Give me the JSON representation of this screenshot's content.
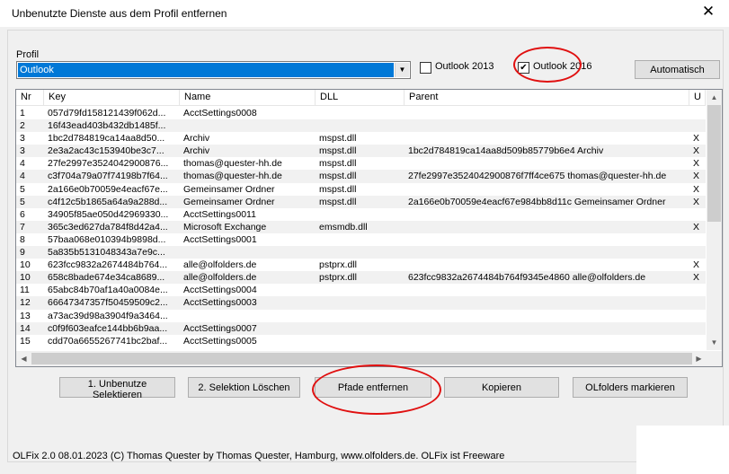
{
  "window": {
    "title": "Unbenutzte Dienste aus dem Profil entfernen",
    "close_glyph": "✕"
  },
  "profile": {
    "label": "Profil",
    "selected": "Outlook"
  },
  "checkboxes": [
    {
      "label": "Outlook 2013",
      "checked": false
    },
    {
      "label": "Outlook 2016",
      "checked": true
    }
  ],
  "automatisch_label": "Automatisch",
  "table": {
    "columns": [
      "Nr",
      "Key",
      "Name",
      "DLL",
      "Parent",
      "U"
    ],
    "rows": [
      {
        "nr": "1",
        "key": "057d79fd158121439f062d...",
        "name": "AcctSettings0008",
        "dll": "",
        "parent": "",
        "u": ""
      },
      {
        "nr": "2",
        "key": "16f43ead403b432db1485f...",
        "name": "",
        "dll": "",
        "parent": "",
        "u": ""
      },
      {
        "nr": "3",
        "key": "1bc2d784819ca14aa8d50...",
        "name": "Archiv",
        "dll": "mspst.dll",
        "parent": "",
        "u": "X"
      },
      {
        "nr": "3",
        "key": "2e3a2ac43c153940be3c7...",
        "name": "Archiv",
        "dll": "mspst.dll",
        "parent": "1bc2d784819ca14aa8d509b85779b6e4 Archiv",
        "u": "X"
      },
      {
        "nr": "4",
        "key": "27fe2997e3524042900876...",
        "name": "thomas@quester-hh.de",
        "dll": "mspst.dll",
        "parent": "",
        "u": "X"
      },
      {
        "nr": "4",
        "key": "c3f704a79a07f74198b7f64...",
        "name": "thomas@quester-hh.de",
        "dll": "mspst.dll",
        "parent": "27fe2997e3524042900876f7ff4ce675 thomas@quester-hh.de",
        "u": "X"
      },
      {
        "nr": "5",
        "key": "2a166e0b70059e4eacf67e...",
        "name": "Gemeinsamer Ordner",
        "dll": "mspst.dll",
        "parent": "",
        "u": "X"
      },
      {
        "nr": "5",
        "key": "c4f12c5b1865a64a9a288d...",
        "name": "Gemeinsamer Ordner",
        "dll": "mspst.dll",
        "parent": "2a166e0b70059e4eacf67e984bb8d11c Gemeinsamer Ordner",
        "u": "X"
      },
      {
        "nr": "6",
        "key": "34905f85ae050d42969330...",
        "name": "AcctSettings0011",
        "dll": "",
        "parent": "",
        "u": ""
      },
      {
        "nr": "7",
        "key": "365c3ed627da784f8d42a4...",
        "name": "Microsoft Exchange",
        "dll": "emsmdb.dll",
        "parent": "",
        "u": "X"
      },
      {
        "nr": "8",
        "key": "57baa068e010394b9898d...",
        "name": "AcctSettings0001",
        "dll": "",
        "parent": "",
        "u": ""
      },
      {
        "nr": "9",
        "key": "5a835b5131048343a7e9c...",
        "name": "",
        "dll": "",
        "parent": "",
        "u": ""
      },
      {
        "nr": "10",
        "key": "623fcc9832a2674484b764...",
        "name": "alle@olfolders.de",
        "dll": "pstprx.dll",
        "parent": "",
        "u": "X"
      },
      {
        "nr": "10",
        "key": "658c8bade674e34ca8689...",
        "name": "alle@olfolders.de",
        "dll": "pstprx.dll",
        "parent": "623fcc9832a2674484b764f9345e4860 alle@olfolders.de",
        "u": "X"
      },
      {
        "nr": "11",
        "key": "65abc84b70af1a40a0084e...",
        "name": "AcctSettings0004",
        "dll": "",
        "parent": "",
        "u": ""
      },
      {
        "nr": "12",
        "key": "666473473​57f50459509c2...",
        "name": "AcctSettings0003",
        "dll": "",
        "parent": "",
        "u": ""
      },
      {
        "nr": "13",
        "key": "a73ac39d98a3904f9a3464...",
        "name": "",
        "dll": "",
        "parent": "",
        "u": ""
      },
      {
        "nr": "14",
        "key": "c0f9f603eafce144bb6b9aa...",
        "name": "AcctSettings0007",
        "dll": "",
        "parent": "",
        "u": ""
      },
      {
        "nr": "15",
        "key": "cdd70a6655267741bc2baf...",
        "name": "AcctSettings0005",
        "dll": "",
        "parent": "",
        "u": ""
      }
    ]
  },
  "buttons": {
    "select_unused": "1. Unbenutze Selektieren",
    "delete_selection": "2. Selektion Löschen",
    "remove_paths": "Pfade entfernen",
    "copy": "Kopieren",
    "mark_olfolders": "OLfolders markieren"
  },
  "footer": "OLFix 2.0 08.01.2023 (C) Thomas Quester by Thomas Quester, Hamburg, www.olfolders.de. OLFix ist Freeware",
  "colors": {
    "selection": "#0078d7",
    "annotation": "#e01010"
  }
}
